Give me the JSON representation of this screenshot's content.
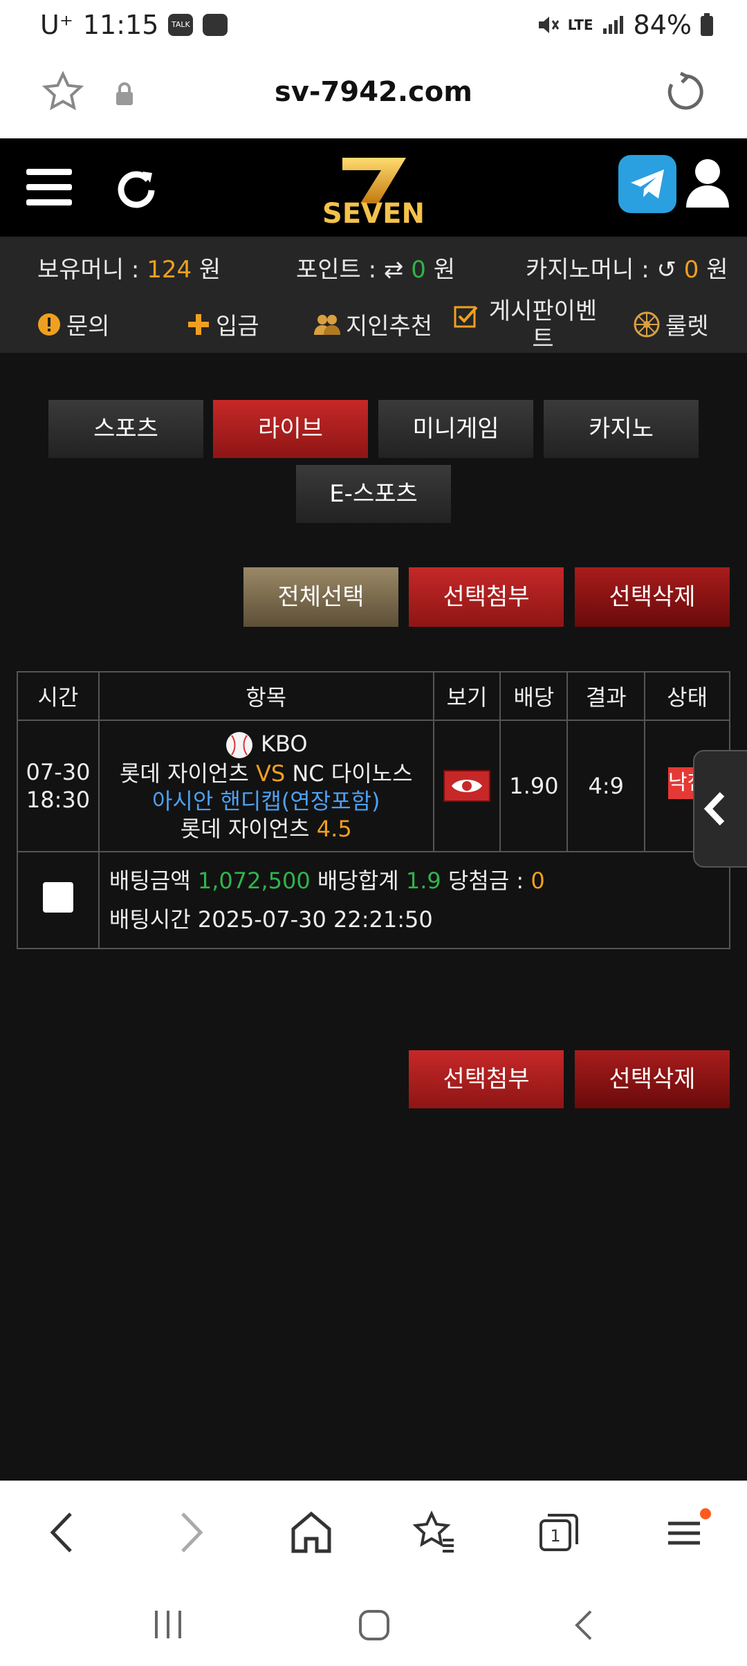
{
  "status_bar": {
    "carrier": "U⁺",
    "time": "11:15",
    "battery": "84%",
    "network": "LTE"
  },
  "browser": {
    "url": "sv-7942.com"
  },
  "header": {
    "logo_text": "SEVEN"
  },
  "balance": {
    "money_label": "보유머니 :",
    "money_value": "124",
    "money_unit": "원",
    "points_label": "포인트 :",
    "points_value": "0",
    "points_unit": "원",
    "casino_label": "카지노머니 :",
    "casino_value": "0",
    "casino_unit": "원"
  },
  "quick_menu": [
    {
      "label": "문의",
      "icon": "alert-icon"
    },
    {
      "label": "입금",
      "icon": "plus-icon"
    },
    {
      "label": "지인추천",
      "icon": "people-icon"
    },
    {
      "label": "게시판이벤트",
      "icon": "checkbox-icon"
    },
    {
      "label": "룰렛",
      "icon": "roulette-icon"
    }
  ],
  "tabs": [
    "스포츠",
    "라이브",
    "미니게임",
    "카지노",
    "E-스포츠"
  ],
  "active_tab": "라이브",
  "actions": {
    "select_all": "전체선택",
    "attach": "선택첨부",
    "delete": "선택삭제"
  },
  "table": {
    "headers": [
      "시간",
      "항목",
      "보기",
      "배당",
      "결과",
      "상태"
    ],
    "row": {
      "date": "07-30",
      "time": "18:30",
      "league": "KBO",
      "home": "롯데 자이언츠",
      "vs": "VS",
      "away": "NC 다이노스",
      "market": "아시안 핸디캡(연장포함)",
      "pick": "롯데 자이언츠",
      "pick_line": "4.5",
      "odds": "1.90",
      "result": "4:9",
      "status": "낙첨"
    },
    "summary": {
      "bet_amount_label": "배팅금액",
      "bet_amount": "1,072,500",
      "odds_total_label": "배당합계",
      "odds_total": "1.9",
      "winnings_label": "당첨금 :",
      "winnings": "0",
      "bet_time_label": "배팅시간",
      "bet_time": "2025-07-30 22:21:50"
    }
  },
  "colors": {
    "accent_red": "#c62828",
    "orange": "#f0a020",
    "green": "#2fb54a",
    "blue": "#4ea0f0",
    "bg": "#121212"
  }
}
